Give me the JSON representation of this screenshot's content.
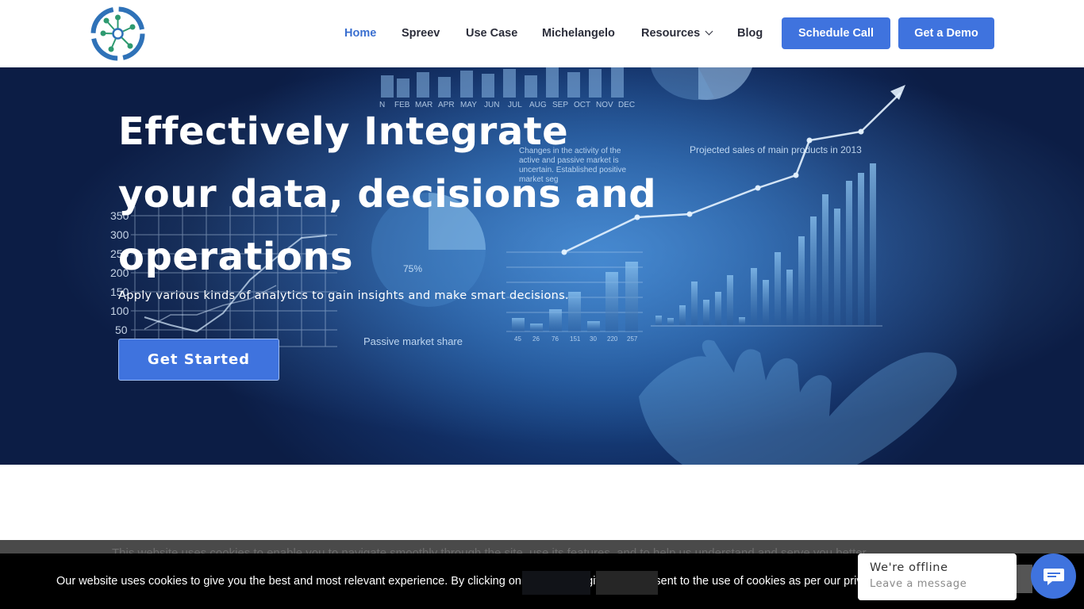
{
  "header": {
    "logo_name": "network-logo-icon",
    "nav": [
      {
        "label": "Home",
        "active": true
      },
      {
        "label": "Spreev"
      },
      {
        "label": "Use Case"
      },
      {
        "label": "Michelangelo"
      },
      {
        "label": "Resources",
        "has_dropdown": true
      },
      {
        "label": "Blog"
      }
    ],
    "schedule_label": "Schedule Call",
    "demo_label": "Get a Demo"
  },
  "hero": {
    "title_line1": "Effectively Integrate",
    "title_line2": "your data, decisions and",
    "title_line3": "operations",
    "subtitle": "Apply various kinds of analytics to gain insights and make smart decisions.",
    "cta_label": "Get Started",
    "bg_labels": {
      "months": [
        "N",
        "FEB",
        "MAR",
        "APR",
        "MAY",
        "JUN",
        "JUL",
        "AUG",
        "SEP",
        "OCT",
        "NOV",
        "DEC"
      ],
      "projected": "Projected sales of main products in 2013",
      "changes": "Changes in the activity of the active and passive market is uncertain. Established positive market seg",
      "passive": "Passive market share",
      "pct75": "75%",
      "y_ticks": [
        "350",
        "300",
        "250",
        "200",
        "150",
        "100",
        "50"
      ],
      "bar_ticks": [
        "45",
        "26",
        "76",
        "151",
        "30",
        "220",
        "257"
      ]
    }
  },
  "cookie": {
    "back_text": "This website uses cookies to enable you to navigate smoothly through the site, use its features, and to help us understand and serve you better.",
    "text": "Our website uses cookies to give you the best and most relevant experience. By clicking on accept, you give your consent to the use of cookies as per our privacy p"
  },
  "chat": {
    "title": "We're offline",
    "subtitle": "Leave a message"
  },
  "colors": {
    "accent": "#3f73de",
    "nav_text": "#2b2d3a",
    "active_nav": "#3a6fd0"
  }
}
